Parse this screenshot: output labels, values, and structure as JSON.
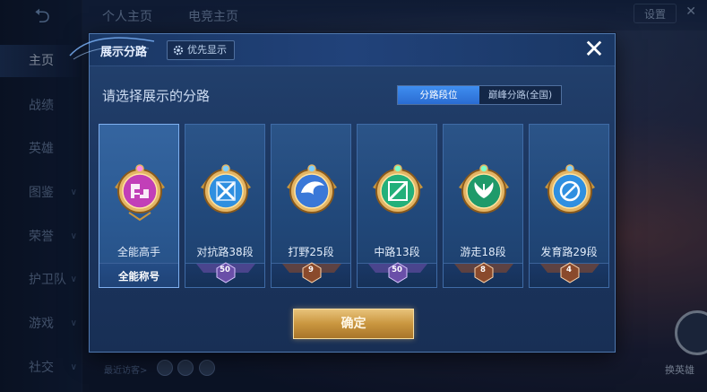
{
  "background": {
    "nav": [
      {
        "label": "主页",
        "active": true
      },
      {
        "label": "战绩"
      },
      {
        "label": "英雄"
      },
      {
        "label": "图鉴",
        "chevron": true
      },
      {
        "label": "荣誉",
        "chevron": true
      },
      {
        "label": "护卫队",
        "chevron": true
      },
      {
        "label": "游戏",
        "chevron": true
      },
      {
        "label": "社交",
        "chevron": true
      }
    ],
    "top_tabs": [
      "个人主页",
      "电竞主页"
    ],
    "settings_label": "设置",
    "visitors_label": "最近访客>",
    "swap_hero_label": "换英雄"
  },
  "modal": {
    "title": "展示分路",
    "priority_label": "优先显示",
    "prompt": "请选择展示的分路",
    "segments": [
      "分路段位",
      "巅峰分路(全国)"
    ],
    "active_segment": 0,
    "cards": [
      {
        "label": "全能高手",
        "footer_text": "全能称号",
        "emblem_color": "#c23fb8",
        "selected": true
      },
      {
        "label": "对抗路38段",
        "rank": "50",
        "emblem_color": "#2f8fe0",
        "badge_color": "#6a4fa8"
      },
      {
        "label": "打野25段",
        "rank": "9",
        "emblem_color": "#3a78d8",
        "badge_color": "#8a4a2c"
      },
      {
        "label": "中路13段",
        "rank": "50",
        "emblem_color": "#23b07a",
        "badge_color": "#6a4fa8"
      },
      {
        "label": "游走18段",
        "rank": "8",
        "emblem_color": "#1f9a6a",
        "badge_color": "#8a4a2c"
      },
      {
        "label": "发育路29段",
        "rank": "4",
        "emblem_color": "#2f8fe0",
        "badge_color": "#8a4a2c"
      }
    ],
    "confirm_label": "确定"
  },
  "colors": {
    "accent_blue": "#2a6cd2",
    "gold": "#c9963f"
  }
}
